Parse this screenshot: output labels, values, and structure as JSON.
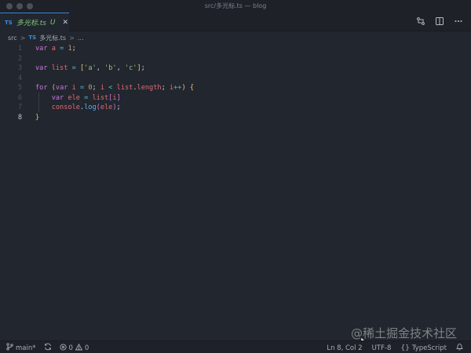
{
  "window": {
    "title": "src/多光标.ts — blog"
  },
  "tab": {
    "badge": "TS",
    "name": "多光标.ts",
    "status": "U",
    "close_glyph": "✕",
    "compare_icon": "compare-changes-icon",
    "split_icon": "split-editor-icon",
    "more_icon": "more-actions-icon"
  },
  "breadcrumb": {
    "folder": "src",
    "sep": ">",
    "file_badge": "TS",
    "file": "多光标.ts",
    "more": "…"
  },
  "editor": {
    "active_line": 8,
    "lines": [
      {
        "no": "1",
        "segments": [
          [
            "kw",
            "var "
          ],
          [
            "id",
            "a"
          ],
          [
            "pl",
            " "
          ],
          [
            "op",
            "="
          ],
          [
            "pl",
            " "
          ],
          [
            "num",
            "1"
          ],
          [
            "pl",
            ";"
          ]
        ]
      },
      {
        "no": "2",
        "segments": []
      },
      {
        "no": "3",
        "segments": [
          [
            "kw",
            "var "
          ],
          [
            "id",
            "list"
          ],
          [
            "pl",
            " "
          ],
          [
            "op",
            "="
          ],
          [
            "pl",
            " "
          ],
          [
            "br1",
            "["
          ],
          [
            "str",
            "'a'"
          ],
          [
            "pl",
            ", "
          ],
          [
            "str",
            "'b'"
          ],
          [
            "pl",
            ", "
          ],
          [
            "str",
            "'c'"
          ],
          [
            "br1",
            "]"
          ],
          [
            "pl",
            ";"
          ]
        ]
      },
      {
        "no": "4",
        "segments": []
      },
      {
        "no": "5",
        "segments": [
          [
            "kw",
            "for "
          ],
          [
            "br1",
            "("
          ],
          [
            "kw",
            "var "
          ],
          [
            "id",
            "i"
          ],
          [
            "pl",
            " "
          ],
          [
            "op",
            "="
          ],
          [
            "pl",
            " "
          ],
          [
            "num",
            "0"
          ],
          [
            "pl",
            "; "
          ],
          [
            "id",
            "i"
          ],
          [
            "pl",
            " "
          ],
          [
            "op",
            "<"
          ],
          [
            "pl",
            " "
          ],
          [
            "id",
            "list"
          ],
          [
            "pl",
            "."
          ],
          [
            "id",
            "length"
          ],
          [
            "pl",
            "; "
          ],
          [
            "id",
            "i"
          ],
          [
            "op",
            "++"
          ],
          [
            "br1",
            ")"
          ],
          [
            "pl",
            " "
          ],
          [
            "br1",
            "{"
          ]
        ]
      },
      {
        "no": "6",
        "segments": [
          [
            "pl",
            "    "
          ],
          [
            "kw",
            "var "
          ],
          [
            "id",
            "ele"
          ],
          [
            "pl",
            " "
          ],
          [
            "op",
            "="
          ],
          [
            "pl",
            " "
          ],
          [
            "id",
            "list"
          ],
          [
            "br2",
            "["
          ],
          [
            "id",
            "i"
          ],
          [
            "br2",
            "]"
          ]
        ]
      },
      {
        "no": "7",
        "segments": [
          [
            "pl",
            "    "
          ],
          [
            "id",
            "console"
          ],
          [
            "pl",
            "."
          ],
          [
            "fn",
            "log"
          ],
          [
            "br2",
            "("
          ],
          [
            "id",
            "ele"
          ],
          [
            "br2",
            ")"
          ],
          [
            "pl",
            ";"
          ]
        ]
      },
      {
        "no": "8",
        "segments": [
          [
            "br1",
            "}"
          ]
        ]
      }
    ]
  },
  "statusbar": {
    "branch": "main*",
    "errors": "0",
    "warnings": "0",
    "position": "Ln 8, Col 2",
    "encoding": "UTF-8",
    "language_glyph": "{}",
    "language": "TypeScript"
  },
  "watermark": "@稀土掘金技术社区"
}
